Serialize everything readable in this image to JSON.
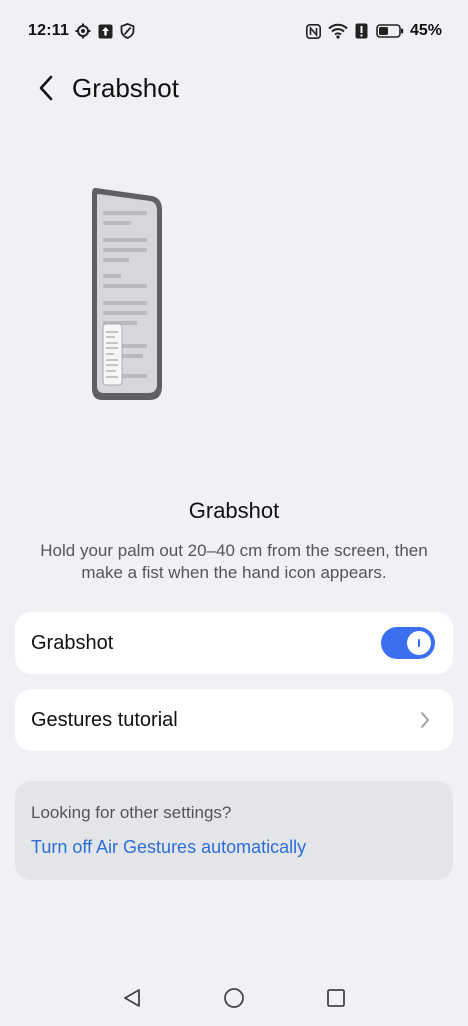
{
  "status_bar": {
    "time": "12:11",
    "battery_percent": "45%",
    "icons_left": [
      "settings-icon",
      "upload-icon",
      "shield-icon"
    ],
    "icons_right": [
      "nfc-icon",
      "wifi-icon",
      "alert-icon",
      "battery-icon"
    ]
  },
  "header": {
    "title": "Grabshot"
  },
  "feature": {
    "title": "Grabshot",
    "description": "Hold your palm out 20–40 cm from the screen, then make a fist when the hand icon appears."
  },
  "settings": {
    "toggle_label": "Grabshot",
    "toggle_on": true,
    "tutorial_label": "Gestures tutorial"
  },
  "other": {
    "question": "Looking for other settings?",
    "link": "Turn off Air Gestures automatically"
  },
  "colors": {
    "accent": "#3b6ff0",
    "link": "#2b6fd6",
    "background": "#f0f1f5"
  },
  "nav": {
    "icons": [
      "back-triangle-icon",
      "home-circle-icon",
      "recents-square-icon"
    ]
  }
}
